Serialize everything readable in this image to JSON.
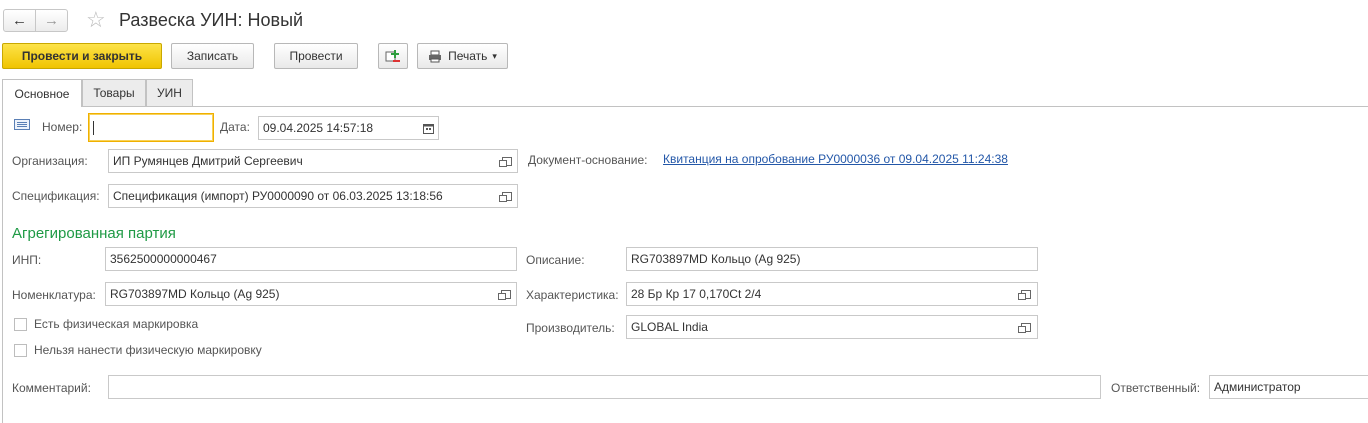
{
  "window": {
    "title": "Развеска УИН: Новый",
    "back_icon": "←",
    "forward_icon": "→",
    "star_icon": "☆"
  },
  "toolbar": {
    "post_close": "Провести и закрыть",
    "save": "Записать",
    "post": "Провести",
    "print": "Печать",
    "print_arrow": "▾"
  },
  "tabs": [
    {
      "label": "Основное"
    },
    {
      "label": "Товары"
    },
    {
      "label": "УИН"
    }
  ],
  "header": {
    "number_label": "Номер:",
    "number_value": "",
    "date_label": "Дата:",
    "date_value": "09.04.2025 14:57:18",
    "org_label": "Организация:",
    "org_value": "ИП Румянцев Дмитрий Сергеевич",
    "basis_label": "Документ-основание:",
    "basis_value": "Квитанция на опробование РУ0000036 от 09.04.2025 11:24:38",
    "spec_label": "Спецификация:",
    "spec_value": "Спецификация (импорт) РУ0000090 от 06.03.2025 13:18:56"
  },
  "batch": {
    "section_title": "Агрегированная партия",
    "inp_label": "ИНП:",
    "inp_value": "3562500000000467",
    "desc_label": "Описание:",
    "desc_value": "RG703897MD Кольцо (Ag 925)",
    "nom_label": "Номенклатура:",
    "nom_value": "RG703897MD Кольцо (Ag 925)",
    "char_label": "Характеристика:",
    "char_value": "28 Бр Кр 17 0,170Ct 2/4",
    "maker_label": "Производитель:",
    "maker_value": "GLOBAL India",
    "phys_mark_label": "Есть физическая маркировка",
    "no_phys_mark_label": "Нельзя нанести физическую маркировку"
  },
  "footer": {
    "comment_label": "Комментарий:",
    "comment_value": "",
    "responsible_label": "Ответственный:",
    "responsible_value": "Администратор"
  }
}
